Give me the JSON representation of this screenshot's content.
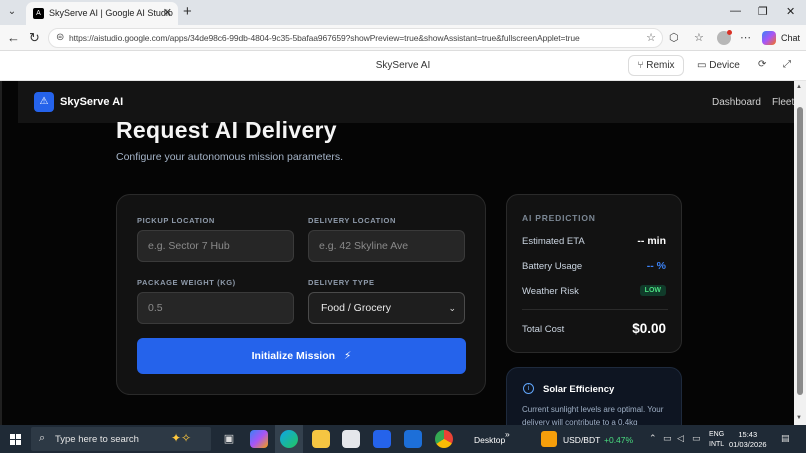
{
  "browser": {
    "tab_title": "SkyServe AI | Google AI Studio",
    "tab_favicon": "A",
    "url": "https://aistudio.google.com/apps/34de98c6-99db-4804-9c35-5bafaa967659?showPreview=true&showAssistant=true&fullscreenApplet=true",
    "chat_label": "Chat"
  },
  "studio": {
    "title": "SkyServe AI",
    "remix_label": "Remix",
    "device_label": "Device"
  },
  "app": {
    "brand": "SkyServe AI",
    "nav": [
      "Dashboard",
      "Fleet"
    ],
    "page_title": "Request AI Delivery",
    "page_subtitle": "Configure your autonomous mission parameters.",
    "form": {
      "pickup_label": "PICKUP LOCATION",
      "pickup_placeholder": "e.g. Sector 7 Hub",
      "delivery_label": "DELIVERY LOCATION",
      "delivery_placeholder": "e.g. 42 Skyline Ave",
      "weight_label": "PACKAGE WEIGHT (KG)",
      "weight_value": "0.5",
      "type_label": "DELIVERY TYPE",
      "type_value": "Food / Grocery",
      "submit_label": "Initialize Mission",
      "submit_icon": "⚡"
    },
    "prediction": {
      "heading": "AI PREDICTION",
      "eta_label": "Estimated ETA",
      "eta_value": "-- min",
      "battery_label": "Battery Usage",
      "battery_value": "-- %",
      "weather_label": "Weather Risk",
      "weather_value": "LOW",
      "total_label": "Total Cost",
      "total_value": "$0.00"
    },
    "solar": {
      "title": "Solar Efficiency",
      "text": "Current sunlight levels are optimal. Your delivery will contribute to a 0.4kg"
    }
  },
  "taskbar": {
    "search_placeholder": "Type here to search",
    "desktop_label": "Desktop",
    "ticker_label": "USD/BDT",
    "ticker_change": "+0.47%",
    "lang_1": "ENG",
    "lang_2": "INTL",
    "time": "15:43",
    "date": "01/03/2026"
  },
  "colors": {
    "accent": "#2563eb",
    "app_bg": "#050505",
    "card_bg": "#121212",
    "badge_green": "#4ade80"
  }
}
